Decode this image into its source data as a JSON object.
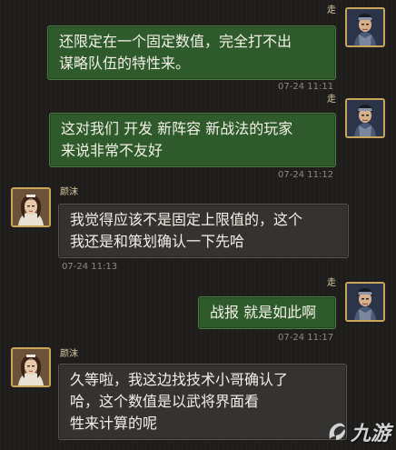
{
  "messages": [
    {
      "sender": "走",
      "side": "right",
      "text": "还限定在一个固定数值，完全打不出\n谋略队伍的特性来。",
      "time": "07-24 11:11"
    },
    {
      "sender": "走",
      "side": "right",
      "text": "这对我们 开发 新阵容 新战法的玩家\n来说非常不友好",
      "time": "07-24 11:12"
    },
    {
      "sender": "颜沫",
      "side": "left",
      "text": "我觉得应该不是固定上限值的，这个\n我还是和策划确认一下先哈",
      "time": "07-24 11:13"
    },
    {
      "sender": "走",
      "side": "right",
      "text": "战报 就是如此啊",
      "time": "07-24 11:17"
    },
    {
      "sender": "颜沫",
      "side": "left",
      "text": "久等啦，我这边找技术小哥确认了\n哈，这个数值是以武将界面看\n牲来计算的呢",
      "time": ""
    }
  ],
  "watermark": {
    "text": "九游",
    "icon": "jiuyou-logo-icon"
  },
  "colors": {
    "me_bubble": "#2f5b2c",
    "other_bubble": "#343331",
    "avatar_border": "#c8a65a"
  }
}
